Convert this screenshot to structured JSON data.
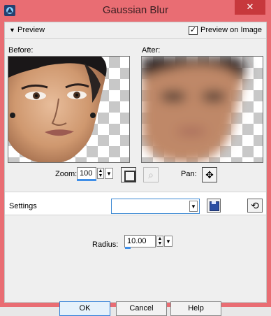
{
  "window": {
    "title": "Gaussian Blur",
    "close_glyph": "✕",
    "accent": "#e96d73"
  },
  "preview": {
    "section_label": "Preview",
    "preview_on_image_label": "Preview on Image",
    "preview_on_image_checked": true
  },
  "panels": {
    "before_label": "Before:",
    "after_label": "After:"
  },
  "zoom": {
    "label": "Zoom:",
    "value": "100"
  },
  "pan": {
    "label": "Pan:",
    "icon": "move-icon"
  },
  "settings": {
    "label": "Settings",
    "selected": ""
  },
  "radius": {
    "label": "Radius:",
    "value": "10.00"
  },
  "buttons": {
    "ok": "OK",
    "cancel": "Cancel",
    "help": "Help"
  }
}
